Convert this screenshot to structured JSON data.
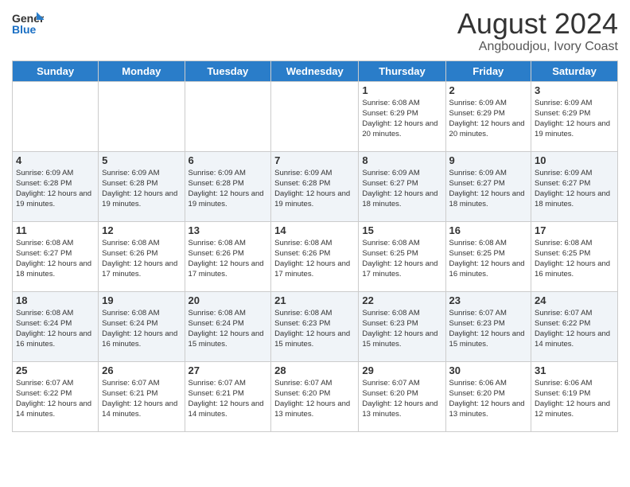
{
  "header": {
    "logo_general": "General",
    "logo_blue": "Blue",
    "title": "August 2024",
    "subtitle": "Angboudjou, Ivory Coast"
  },
  "calendar": {
    "days_of_week": [
      "Sunday",
      "Monday",
      "Tuesday",
      "Wednesday",
      "Thursday",
      "Friday",
      "Saturday"
    ],
    "weeks": [
      [
        {
          "day": "",
          "info": ""
        },
        {
          "day": "",
          "info": ""
        },
        {
          "day": "",
          "info": ""
        },
        {
          "day": "",
          "info": ""
        },
        {
          "day": "1",
          "info": "Sunrise: 6:08 AM\nSunset: 6:29 PM\nDaylight: 12 hours and 20 minutes."
        },
        {
          "day": "2",
          "info": "Sunrise: 6:09 AM\nSunset: 6:29 PM\nDaylight: 12 hours and 20 minutes."
        },
        {
          "day": "3",
          "info": "Sunrise: 6:09 AM\nSunset: 6:29 PM\nDaylight: 12 hours and 19 minutes."
        }
      ],
      [
        {
          "day": "4",
          "info": "Sunrise: 6:09 AM\nSunset: 6:28 PM\nDaylight: 12 hours and 19 minutes."
        },
        {
          "day": "5",
          "info": "Sunrise: 6:09 AM\nSunset: 6:28 PM\nDaylight: 12 hours and 19 minutes."
        },
        {
          "day": "6",
          "info": "Sunrise: 6:09 AM\nSunset: 6:28 PM\nDaylight: 12 hours and 19 minutes."
        },
        {
          "day": "7",
          "info": "Sunrise: 6:09 AM\nSunset: 6:28 PM\nDaylight: 12 hours and 19 minutes."
        },
        {
          "day": "8",
          "info": "Sunrise: 6:09 AM\nSunset: 6:27 PM\nDaylight: 12 hours and 18 minutes."
        },
        {
          "day": "9",
          "info": "Sunrise: 6:09 AM\nSunset: 6:27 PM\nDaylight: 12 hours and 18 minutes."
        },
        {
          "day": "10",
          "info": "Sunrise: 6:09 AM\nSunset: 6:27 PM\nDaylight: 12 hours and 18 minutes."
        }
      ],
      [
        {
          "day": "11",
          "info": "Sunrise: 6:08 AM\nSunset: 6:27 PM\nDaylight: 12 hours and 18 minutes."
        },
        {
          "day": "12",
          "info": "Sunrise: 6:08 AM\nSunset: 6:26 PM\nDaylight: 12 hours and 17 minutes."
        },
        {
          "day": "13",
          "info": "Sunrise: 6:08 AM\nSunset: 6:26 PM\nDaylight: 12 hours and 17 minutes."
        },
        {
          "day": "14",
          "info": "Sunrise: 6:08 AM\nSunset: 6:26 PM\nDaylight: 12 hours and 17 minutes."
        },
        {
          "day": "15",
          "info": "Sunrise: 6:08 AM\nSunset: 6:25 PM\nDaylight: 12 hours and 17 minutes."
        },
        {
          "day": "16",
          "info": "Sunrise: 6:08 AM\nSunset: 6:25 PM\nDaylight: 12 hours and 16 minutes."
        },
        {
          "day": "17",
          "info": "Sunrise: 6:08 AM\nSunset: 6:25 PM\nDaylight: 12 hours and 16 minutes."
        }
      ],
      [
        {
          "day": "18",
          "info": "Sunrise: 6:08 AM\nSunset: 6:24 PM\nDaylight: 12 hours and 16 minutes."
        },
        {
          "day": "19",
          "info": "Sunrise: 6:08 AM\nSunset: 6:24 PM\nDaylight: 12 hours and 16 minutes."
        },
        {
          "day": "20",
          "info": "Sunrise: 6:08 AM\nSunset: 6:24 PM\nDaylight: 12 hours and 15 minutes."
        },
        {
          "day": "21",
          "info": "Sunrise: 6:08 AM\nSunset: 6:23 PM\nDaylight: 12 hours and 15 minutes."
        },
        {
          "day": "22",
          "info": "Sunrise: 6:08 AM\nSunset: 6:23 PM\nDaylight: 12 hours and 15 minutes."
        },
        {
          "day": "23",
          "info": "Sunrise: 6:07 AM\nSunset: 6:23 PM\nDaylight: 12 hours and 15 minutes."
        },
        {
          "day": "24",
          "info": "Sunrise: 6:07 AM\nSunset: 6:22 PM\nDaylight: 12 hours and 14 minutes."
        }
      ],
      [
        {
          "day": "25",
          "info": "Sunrise: 6:07 AM\nSunset: 6:22 PM\nDaylight: 12 hours and 14 minutes."
        },
        {
          "day": "26",
          "info": "Sunrise: 6:07 AM\nSunset: 6:21 PM\nDaylight: 12 hours and 14 minutes."
        },
        {
          "day": "27",
          "info": "Sunrise: 6:07 AM\nSunset: 6:21 PM\nDaylight: 12 hours and 14 minutes."
        },
        {
          "day": "28",
          "info": "Sunrise: 6:07 AM\nSunset: 6:20 PM\nDaylight: 12 hours and 13 minutes."
        },
        {
          "day": "29",
          "info": "Sunrise: 6:07 AM\nSunset: 6:20 PM\nDaylight: 12 hours and 13 minutes."
        },
        {
          "day": "30",
          "info": "Sunrise: 6:06 AM\nSunset: 6:20 PM\nDaylight: 12 hours and 13 minutes."
        },
        {
          "day": "31",
          "info": "Sunrise: 6:06 AM\nSunset: 6:19 PM\nDaylight: 12 hours and 12 minutes."
        }
      ]
    ]
  }
}
